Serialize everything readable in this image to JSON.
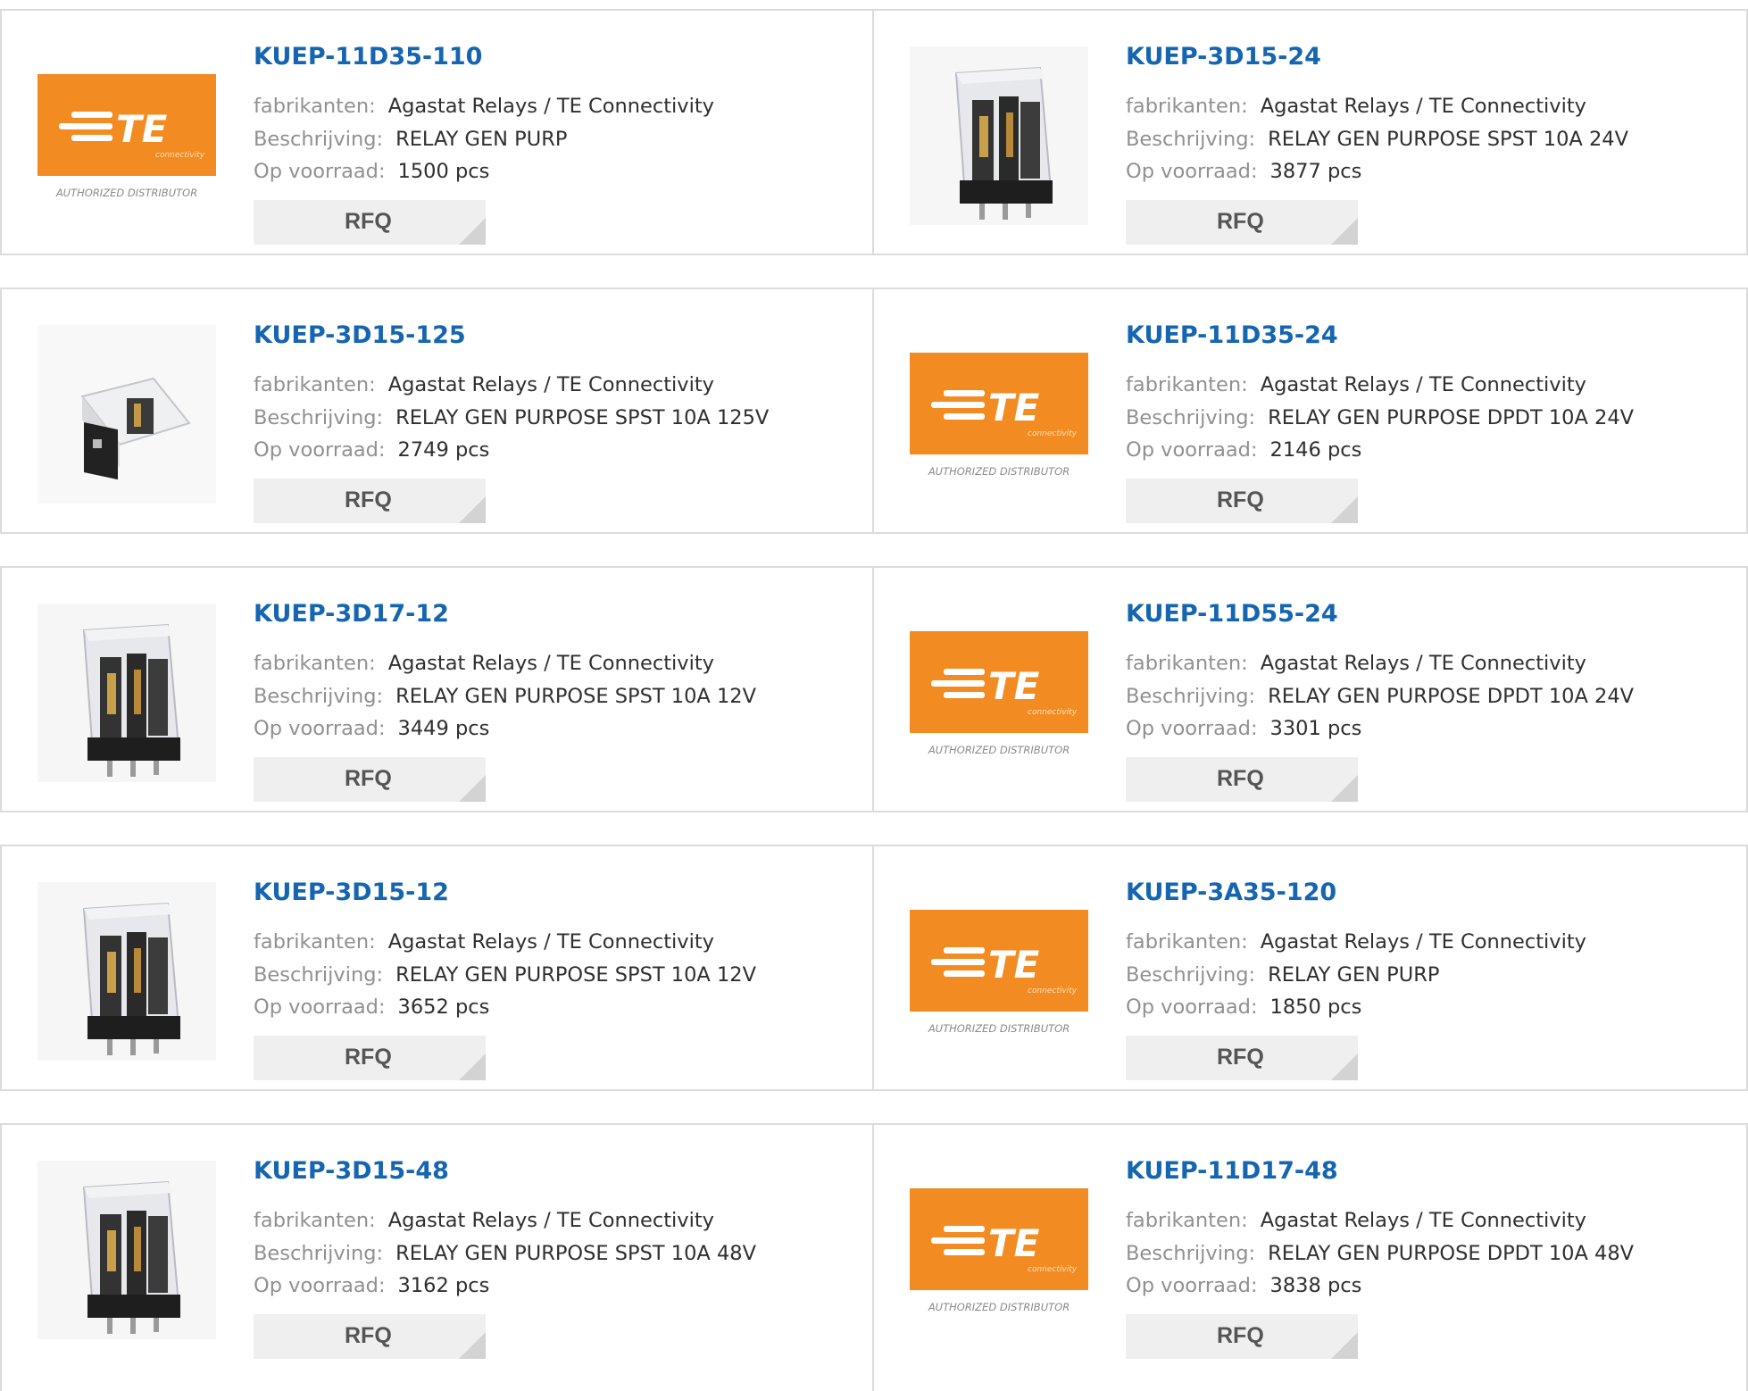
{
  "labels": {
    "manufacturer": "fabrikanten:",
    "description": "Beschrijving:",
    "stock": "Op voorraad:",
    "rfq": "RFQ"
  },
  "te_logo": {
    "brand": "TE",
    "tagline": "connectivity",
    "caption": "AUTHORIZED DISTRIBUTOR",
    "brand_color": "#f28c22"
  },
  "colors": {
    "link": "#1565b0",
    "label": "#909090",
    "value": "#2f2f2f",
    "border": "#dcdcdc",
    "button_bg": "#efefef"
  },
  "products": [
    {
      "part": "KUEP-11D35-110",
      "manufacturer": "Agastat Relays / TE Connectivity",
      "description": "RELAY GEN PURP",
      "stock": "1500 pcs",
      "image": "te-logo"
    },
    {
      "part": "KUEP-3D15-24",
      "manufacturer": "Agastat Relays / TE Connectivity",
      "description": "RELAY GEN PURPOSE SPST 10A 24V",
      "stock": "3877 pcs",
      "image": "relay-photo"
    },
    {
      "part": "KUEP-3D15-125",
      "manufacturer": "Agastat Relays / TE Connectivity",
      "description": "RELAY GEN PURPOSE SPST 10A 125V",
      "stock": "2749 pcs",
      "image": "relay-photo-side"
    },
    {
      "part": "KUEP-11D35-24",
      "manufacturer": "Agastat Relays / TE Connectivity",
      "description": "RELAY GEN PURPOSE DPDT 10A 24V",
      "stock": "2146 pcs",
      "image": "te-logo"
    },
    {
      "part": "KUEP-3D17-12",
      "manufacturer": "Agastat Relays / TE Connectivity",
      "description": "RELAY GEN PURPOSE SPST 10A 12V",
      "stock": "3449 pcs",
      "image": "relay-photo"
    },
    {
      "part": "KUEP-11D55-24",
      "manufacturer": "Agastat Relays / TE Connectivity",
      "description": "RELAY GEN PURPOSE DPDT 10A 24V",
      "stock": "3301 pcs",
      "image": "te-logo"
    },
    {
      "part": "KUEP-3D15-12",
      "manufacturer": "Agastat Relays / TE Connectivity",
      "description": "RELAY GEN PURPOSE SPST 10A 12V",
      "stock": "3652 pcs",
      "image": "relay-photo"
    },
    {
      "part": "KUEP-3A35-120",
      "manufacturer": "Agastat Relays / TE Connectivity",
      "description": "RELAY GEN PURP",
      "stock": "1850 pcs",
      "image": "te-logo"
    },
    {
      "part": "KUEP-3D15-48",
      "manufacturer": "Agastat Relays / TE Connectivity",
      "description": "RELAY GEN PURPOSE SPST 10A 48V",
      "stock": "3162 pcs",
      "image": "relay-photo"
    },
    {
      "part": "KUEP-11D17-48",
      "manufacturer": "Agastat Relays / TE Connectivity",
      "description": "RELAY GEN PURPOSE DPDT 10A 48V",
      "stock": "3838 pcs",
      "image": "te-logo"
    }
  ]
}
